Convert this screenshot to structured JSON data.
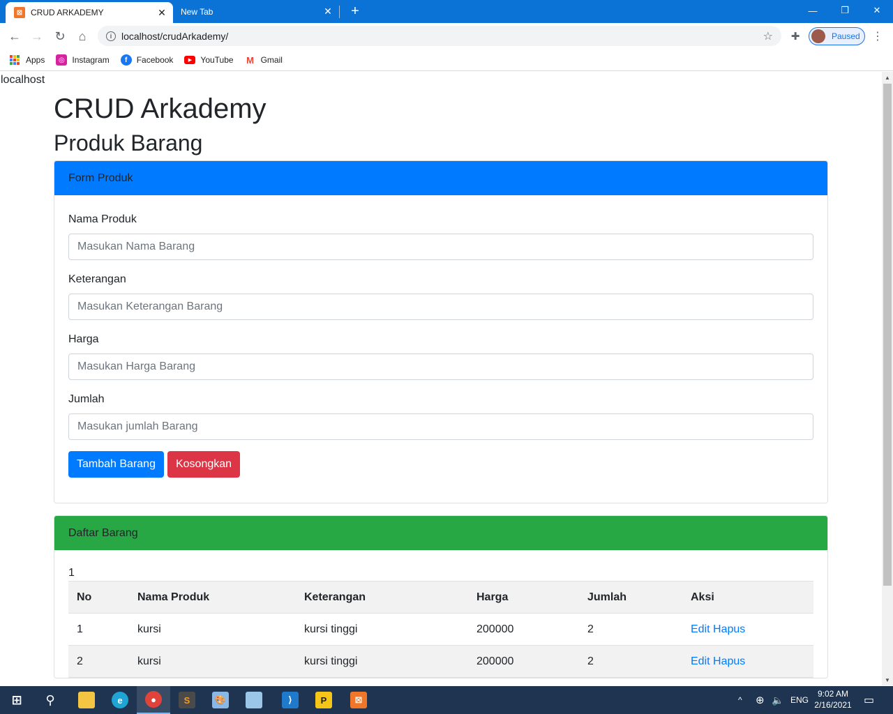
{
  "browser": {
    "tabs": [
      {
        "title": "CRUD ARKADEMY",
        "favicon": "xampp-icon"
      },
      {
        "title": "New Tab"
      }
    ],
    "url": "localhost/crudArkademy/",
    "profile_label": "Paused",
    "bookmarks": [
      {
        "label": "Apps",
        "icon": "apps-grid-icon"
      },
      {
        "label": "Instagram",
        "icon": "instagram-icon",
        "color": "#d6249f"
      },
      {
        "label": "Facebook",
        "icon": "facebook-icon",
        "color": "#1877f2"
      },
      {
        "label": "YouTube",
        "icon": "youtube-icon",
        "color": "#ff0000"
      },
      {
        "label": "Gmail",
        "icon": "gmail-icon",
        "color": "#ea4335"
      }
    ]
  },
  "page": {
    "host_text": "localhost",
    "title": "CRUD Arkademy",
    "subtitle": "Produk Barang",
    "form_card": {
      "header": "Form Produk",
      "fields": [
        {
          "label": "Nama Produk",
          "placeholder": "Masukan Nama Barang"
        },
        {
          "label": "Keterangan",
          "placeholder": "Masukan Keterangan Barang"
        },
        {
          "label": "Harga",
          "placeholder": "Masukan Harga Barang"
        },
        {
          "label": "Jumlah",
          "placeholder": "Masukan jumlah Barang"
        }
      ],
      "submit_label": "Tambah Barang",
      "reset_label": "Kosongkan"
    },
    "list_card": {
      "header": "Daftar Barang",
      "count_text": "1",
      "columns": [
        "No",
        "Nama Produk",
        "Keterangan",
        "Harga",
        "Jumlah",
        "Aksi"
      ],
      "rows": [
        {
          "no": "1",
          "nama": "kursi",
          "keterangan": "kursi tinggi",
          "harga": "200000",
          "jumlah": "2",
          "edit": "Edit",
          "hapus": "Hapus"
        },
        {
          "no": "2",
          "nama": "kursi",
          "keterangan": "kursi tinggi",
          "harga": "200000",
          "jumlah": "2",
          "edit": "Edit",
          "hapus": "Hapus"
        }
      ]
    }
  },
  "taskbar": {
    "language": "ENG",
    "time": "9:02 AM",
    "date": "2/16/2021"
  },
  "colors": {
    "primary": "#007bff",
    "success": "#28a745",
    "danger": "#dc3545",
    "chrome_tabbar": "#0c73d6",
    "taskbar": "#1e3450"
  }
}
